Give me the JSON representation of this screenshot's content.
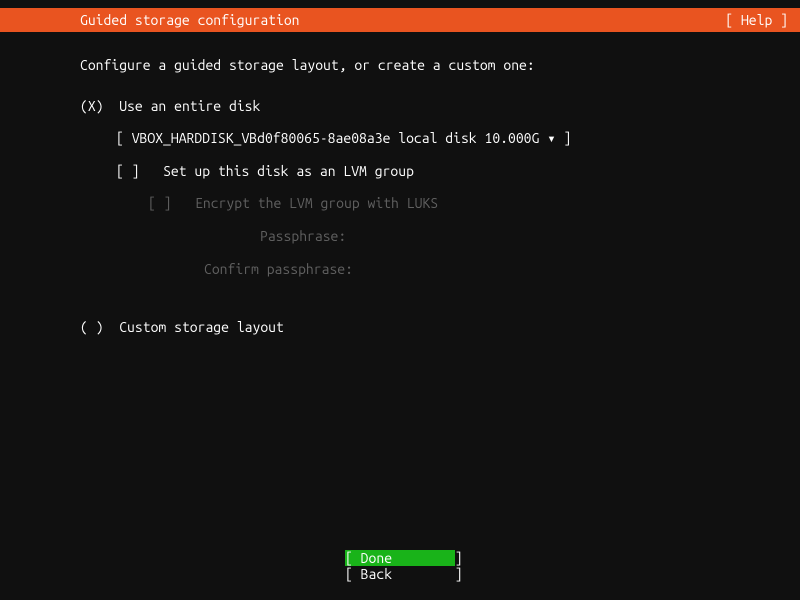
{
  "header": {
    "title": "Guided storage configuration",
    "help": "[ Help ]"
  },
  "intro": "Configure a guided storage layout, or create a custom one:",
  "options": {
    "use_entire_disk": {
      "marker": "(X)",
      "label": "Use an entire disk"
    },
    "disk_selector": {
      "open": "[ ",
      "value": "VBOX_HARDDISK_VBd0f80065-8ae08a3e local disk 10.000G",
      "arrow": " ▾ ",
      "close": "]"
    },
    "lvm": {
      "marker": "[ ]",
      "label": "Set up this disk as an LVM group"
    },
    "luks": {
      "marker": "[ ]",
      "label": "Encrypt the LVM group with LUKS"
    },
    "passphrase_label": "Passphrase:",
    "confirm_passphrase_label": "Confirm passphrase:",
    "custom": {
      "marker": "( )",
      "label": "Custom storage layout"
    }
  },
  "footer": {
    "done": "[ Done        ]",
    "back": "[ Back        ]"
  }
}
